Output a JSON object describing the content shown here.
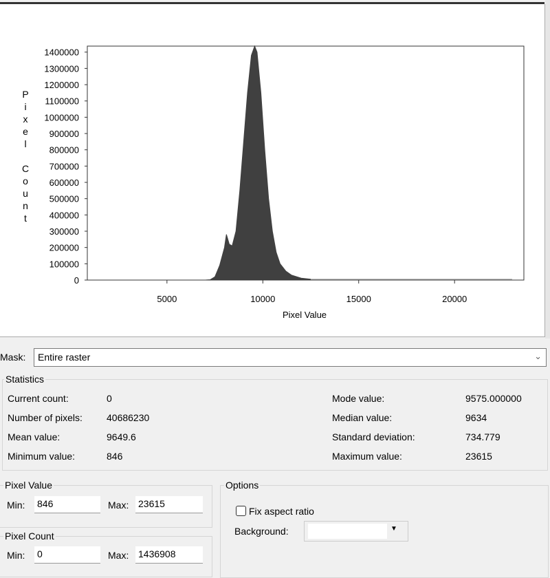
{
  "mask": {
    "label": "Mask:",
    "value": "Entire raster"
  },
  "statistics": {
    "title": "Statistics",
    "rows": [
      {
        "label": "Current count:",
        "value": "0"
      },
      {
        "label": "Number of pixels:",
        "value": "40686230"
      },
      {
        "label": "Mean value:",
        "value": "9649.6"
      },
      {
        "label": "Minimum value:",
        "value": "846"
      },
      {
        "label": "Mode value:",
        "value": "9575.000000"
      },
      {
        "label": "Median value:",
        "value": "9634"
      },
      {
        "label": "Standard deviation:",
        "value": "734.779"
      },
      {
        "label": "Maximum value:",
        "value": "23615"
      }
    ]
  },
  "pixel_value": {
    "title": "Pixel Value",
    "min_label": "Min:",
    "min": "846",
    "max_label": "Max:",
    "max": "23615"
  },
  "pixel_count": {
    "title": "Pixel Count",
    "min_label": "Min:",
    "min": "0",
    "max_label": "Max:",
    "max": "1436908"
  },
  "options": {
    "title": "Options",
    "fix_aspect": "Fix aspect ratio",
    "fix_aspect_checked": false,
    "background_label": "Background:"
  },
  "chart_data": {
    "type": "area",
    "title": "",
    "xlabel": "Pixel Value",
    "ylabel": "Pixel Count",
    "xlim": [
      846,
      23615
    ],
    "ylim": [
      0,
      1436908
    ],
    "xticks": [
      5000,
      10000,
      15000,
      20000
    ],
    "yticks": [
      0,
      100000,
      200000,
      300000,
      400000,
      500000,
      600000,
      700000,
      800000,
      900000,
      1000000,
      1100000,
      1200000,
      1300000,
      1400000
    ],
    "x": [
      846,
      7000,
      7250,
      7500,
      7750,
      8000,
      8100,
      8250,
      8400,
      8600,
      8800,
      9000,
      9200,
      9400,
      9575,
      9700,
      9900,
      10100,
      10300,
      10500,
      10700,
      10900,
      11200,
      11500,
      12000,
      12500,
      13000,
      23615
    ],
    "y": [
      0,
      0,
      2000,
      20000,
      90000,
      200000,
      280000,
      220000,
      210000,
      300000,
      550000,
      850000,
      1150000,
      1380000,
      1436908,
      1400000,
      1150000,
      800000,
      500000,
      300000,
      170000,
      100000,
      55000,
      30000,
      12000,
      5000,
      0,
      0
    ],
    "fill_color": "#404040",
    "grid": false
  }
}
